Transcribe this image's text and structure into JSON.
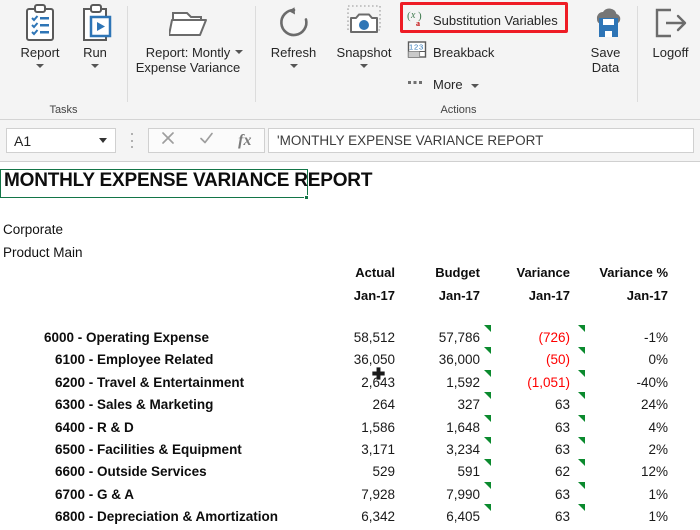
{
  "ribbon": {
    "groups": [
      {
        "name": "tasks",
        "label": "Tasks"
      },
      {
        "name": "actions",
        "label": "Actions"
      }
    ],
    "buttons": {
      "report": {
        "label": "Report",
        "icon": "clipboard-list-icon",
        "has_dropdown": true
      },
      "run": {
        "label": "Run",
        "icon": "clipboard-play-icon",
        "has_dropdown": true
      },
      "report_name": {
        "label": "Report: Montly\nExpense Variance",
        "icon": "open-folder-icon",
        "has_dropdown": true
      },
      "refresh": {
        "label": "Refresh",
        "icon": "refresh-circular-arrow-icon",
        "has_dropdown": true
      },
      "snapshot": {
        "label": "Snapshot",
        "icon": "camera-icon",
        "has_dropdown": true
      },
      "substitution_variables": {
        "label": "Substitution Variables",
        "icon": "variable-xa-icon",
        "highlighted": true
      },
      "breakback": {
        "label": "Breakback",
        "icon": "grid-123-icon"
      },
      "more": {
        "label": "More",
        "icon": "ellipsis-icon",
        "has_dropdown": true
      },
      "save_data": {
        "label": "Save\nData",
        "icon": "cloud-save-icon"
      },
      "logoff": {
        "label": "Logoff",
        "icon": "exit-arrow-icon"
      }
    },
    "highlight_color": "#ee1c25"
  },
  "formula_bar": {
    "name_box_value": "A1",
    "cancel_icon": "close-x-icon",
    "confirm_icon": "check-icon",
    "function_icon": "fx-icon",
    "formula_value": "'MONTHLY EXPENSE VARIANCE REPORT"
  },
  "sheet": {
    "selected_cell": "A1",
    "selection_color": "#137547",
    "title": "MONTHLY EXPENSE VARIANCE REPORT",
    "subtitle_lines": [
      "Corporate",
      "Product Main"
    ],
    "cursor_icon": "excel-cross-cursor-icon"
  },
  "table": {
    "columns": [
      {
        "name": "label",
        "header1": "",
        "header2": ""
      },
      {
        "name": "actual",
        "header1": "Actual",
        "header2": "Jan-17"
      },
      {
        "name": "budget",
        "header1": "Budget",
        "header2": "Jan-17"
      },
      {
        "name": "variance",
        "header1": "Variance",
        "header2": "Jan-17"
      },
      {
        "name": "variance_pct",
        "header1": "Variance %",
        "header2": "Jan-17"
      }
    ],
    "rows": [
      {
        "label": "6000 - Operating Expense",
        "actual": "58,512",
        "budget": "57,786",
        "variance": "(726)",
        "variance_negative": true,
        "variance_pct": "-1%",
        "indent": 0
      },
      {
        "label": "6100 - Employee Related",
        "actual": "36,050",
        "budget": "36,000",
        "variance": "(50)",
        "variance_negative": true,
        "variance_pct": "0%",
        "indent": 1
      },
      {
        "label": "6200 - Travel & Entertainment",
        "actual": "2,643",
        "budget": "1,592",
        "variance": "(1,051)",
        "variance_negative": true,
        "variance_pct": "-40%",
        "indent": 1
      },
      {
        "label": "6300 - Sales & Marketing",
        "actual": "264",
        "budget": "327",
        "variance": "63",
        "variance_negative": false,
        "variance_pct": "24%",
        "indent": 1
      },
      {
        "label": "6400 - R & D",
        "actual": "1,586",
        "budget": "1,648",
        "variance": "63",
        "variance_negative": false,
        "variance_pct": "4%",
        "indent": 1
      },
      {
        "label": "6500 - Facilities & Equipment",
        "actual": "3,171",
        "budget": "3,234",
        "variance": "63",
        "variance_negative": false,
        "variance_pct": "2%",
        "indent": 1
      },
      {
        "label": "6600 - Outside Services",
        "actual": "529",
        "budget": "591",
        "variance": "62",
        "variance_negative": false,
        "variance_pct": "12%",
        "indent": 1
      },
      {
        "label": "6700 - G & A",
        "actual": "7,928",
        "budget": "7,990",
        "variance": "63",
        "variance_negative": false,
        "variance_pct": "1%",
        "indent": 1
      },
      {
        "label": "6800 - Depreciation & Amortization",
        "actual": "6,342",
        "budget": "6,405",
        "variance": "63",
        "variance_negative": false,
        "variance_pct": "1%",
        "indent": 1
      }
    ],
    "comment_marker_color": "#0b8a2e",
    "negative_color": "#ff0000"
  }
}
